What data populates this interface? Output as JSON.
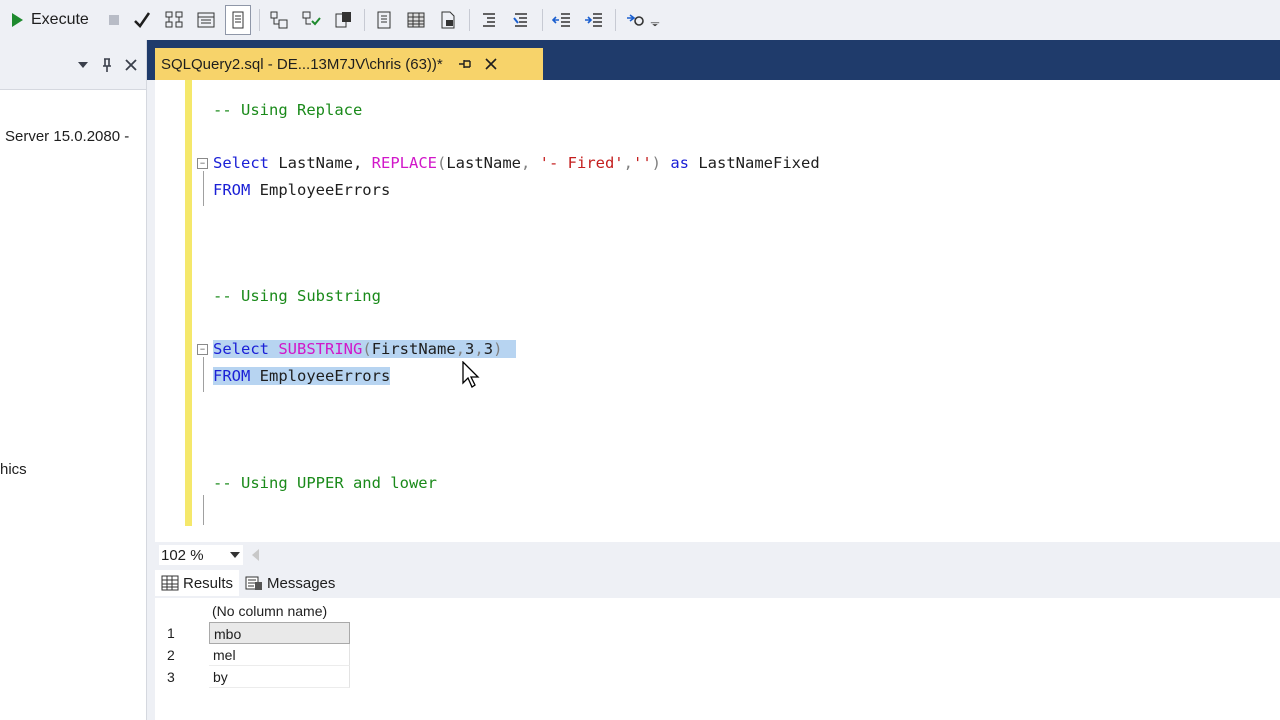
{
  "toolbar": {
    "execute_label": "Execute",
    "icons": [
      "stop-icon",
      "check-parse-icon",
      "display-plan-icon",
      "query-options-icon",
      "intellisense-icon",
      "results-to-text-icon",
      "results-to-grid-icon",
      "results-to-file-icon",
      "comment-icon",
      "uncomment-icon",
      "decrease-indent-icon",
      "increase-indent-icon",
      "specify-values-icon",
      "dropdown-icon"
    ]
  },
  "left_panel": {
    "server_text": "Server 15.0.2080 -",
    "partial_text": "hics"
  },
  "document_tab": {
    "title": "SQLQuery2.sql - DE...13M7JV\\chris (63))*"
  },
  "editor": {
    "lines": {
      "comment_replace": "-- Using Replace",
      "select_replace": {
        "kw_select": "Select",
        "col1": " LastName, ",
        "fn_replace": "REPLACE",
        "paren_open": "(",
        "arg1": "LastName",
        "comma1": ", ",
        "str1": "'- Fired'",
        "comma2": ",",
        "str2": "''",
        "paren_close": ") ",
        "kw_as": "as",
        "alias": " LastNameFixed"
      },
      "from_replace": {
        "kw_from": "FROM",
        "table": " EmployeeErrors"
      },
      "comment_substring": "-- Using Substring",
      "select_substring": {
        "kw_select": "Select",
        "space": " ",
        "fn_substring": "SUBSTRING",
        "paren_open": "(",
        "arg1": "FirstName",
        "c1": ",",
        "n1": "3",
        "c2": ",",
        "n2": "3",
        "paren_close": ")"
      },
      "from_substring": {
        "kw_from": "FROM",
        "table": " EmployeeErrors"
      },
      "comment_upper": "-- Using UPPER and lower"
    }
  },
  "zoom": {
    "value": "102 %"
  },
  "results": {
    "tabs": {
      "results": "Results",
      "messages": "Messages"
    },
    "column_header": "(No column name)",
    "rows": [
      {
        "n": "1",
        "value": "mbo"
      },
      {
        "n": "2",
        "value": "mel"
      },
      {
        "n": "3",
        "value": "by"
      }
    ]
  },
  "colors": {
    "tab_active": "#f7d36a",
    "tabstrip": "#1f3b6b",
    "keyword": "#1b20d6",
    "function": "#d117c9",
    "string": "#c41e1e",
    "comment": "#1a8a1a",
    "selection": "#b7d4f1"
  }
}
